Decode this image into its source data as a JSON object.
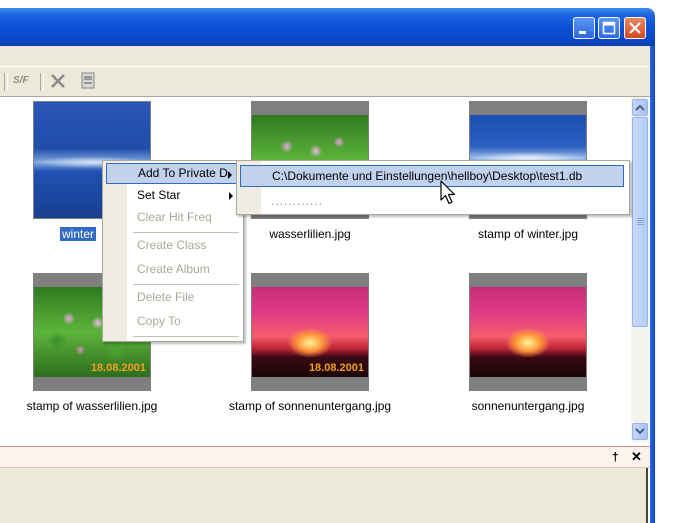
{
  "toolbar": {
    "sf_label": "S/F"
  },
  "thumbnails": [
    {
      "caption": "winter",
      "selected": true
    },
    {
      "caption": "wasserlilien.jpg"
    },
    {
      "caption": "stamp of winter.jpg"
    },
    {
      "caption": "stamp of wasserlilien.jpg",
      "stamp": "18.08.2001"
    },
    {
      "caption": "stamp of sonnenuntergang.jpg",
      "stamp": "18.08.2001"
    },
    {
      "caption": "sonnenuntergang.jpg"
    }
  ],
  "context_menu": {
    "items": [
      {
        "label": "Add To Private D",
        "highlighted": true,
        "submenu": true
      },
      {
        "label": "Set Star",
        "submenu": true
      },
      {
        "label": "Clear Hit Freq",
        "disabled": true
      },
      {
        "label": "Create Class",
        "disabled": true
      },
      {
        "label": "Create Album",
        "disabled": true
      },
      {
        "label": "Delete File",
        "disabled": true
      },
      {
        "label": "Copy To",
        "disabled": true
      }
    ]
  },
  "submenu": {
    "items": [
      {
        "label": "C:\\Dokumente und Einstellungen\\hellboy\\Desktop\\test1.db",
        "highlighted": true
      },
      {
        "label": "............"
      }
    ]
  },
  "panel": {
    "pin_glyph": "†",
    "close_glyph": "✕"
  },
  "colors": {
    "selection": "#316ac5",
    "menu_highlight": "#c1d2ee",
    "titlebar": "#0a4fd6"
  }
}
